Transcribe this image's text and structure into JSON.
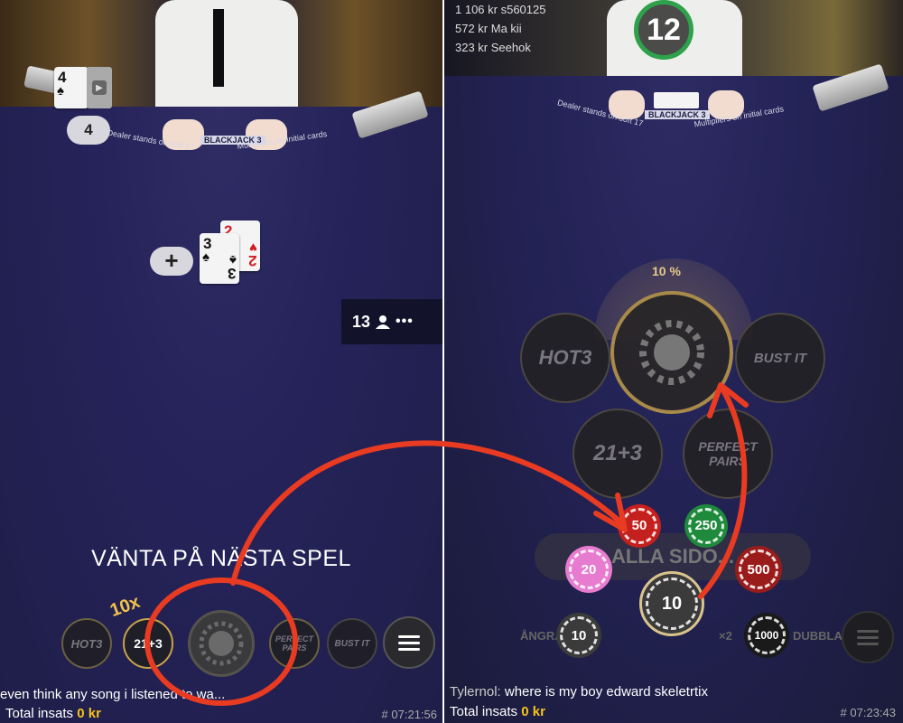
{
  "left_panel": {
    "dealer_card": {
      "rank": "4",
      "suit": "♠"
    },
    "dealer_score": "4",
    "table_label": "BLACKJACK 3",
    "table_rule_left": "Dealer stands on soft 17",
    "table_rule_right": "Multipliers on initial cards",
    "player_cards": [
      {
        "rank": "2",
        "suit": "♥",
        "color": "red"
      },
      {
        "rank": "3",
        "suit": "♠",
        "color": "black"
      }
    ],
    "add_button": "+",
    "player_count": "13",
    "wait_message": "VÄNTA PÅ NÄSTA SPEL",
    "multiplier_badge": "10x",
    "sidebets": {
      "hot3": "HOT3",
      "twentyone": "21+3",
      "perfect_pairs": "PERFECT PAIRS",
      "bust_it": "BUST IT"
    },
    "chat_line": "even think any song i listened to wa...",
    "total_label": "Total insats",
    "total_value": "0 kr",
    "game_id": "# 07:21:56"
  },
  "right_panel": {
    "leaderboard": [
      "1 106 kr s560125",
      "572 kr Ma kii",
      "323 kr Seehok"
    ],
    "timer": "12",
    "table_rule_left": "Dealer stands on soft 17",
    "table_rule_right": "Multipliers on initial cards",
    "table_label": "BLACKJACK 3",
    "percent": "10 %",
    "sidebets": {
      "hot3": "HOT3",
      "bust_it": "BUST IT",
      "twentyone": "21+3",
      "perfect_pairs": "PERFECT PAIRS"
    },
    "all_sidebets_button": "ALLA SIDO...",
    "undo_label": "ÅNGRA",
    "double_label": "DUBBLA",
    "double_prefix": "×2",
    "chips": [
      {
        "value": "50",
        "color": "#c4201d"
      },
      {
        "value": "250",
        "color": "#1f8a3c"
      },
      {
        "value": "20",
        "color": "#e77bcf"
      },
      {
        "value": "500",
        "color": "#9a1c1a"
      },
      {
        "value": "10",
        "color": "#3b3b3b"
      },
      {
        "value": "10",
        "color": "#3b3b3b"
      },
      {
        "value": "1000",
        "color": "#1a1a1a"
      }
    ],
    "chat_user": "Tylernol:",
    "chat_message": "where is my boy edward skeletrtix",
    "total_label": "Total insats",
    "total_value": "0 kr",
    "game_id": "# 07:23:43"
  },
  "colors": {
    "annotation": "#e83b22",
    "felt": "#23224f",
    "accent_yellow": "#f5c21b",
    "timer_green": "#2ea24a"
  }
}
